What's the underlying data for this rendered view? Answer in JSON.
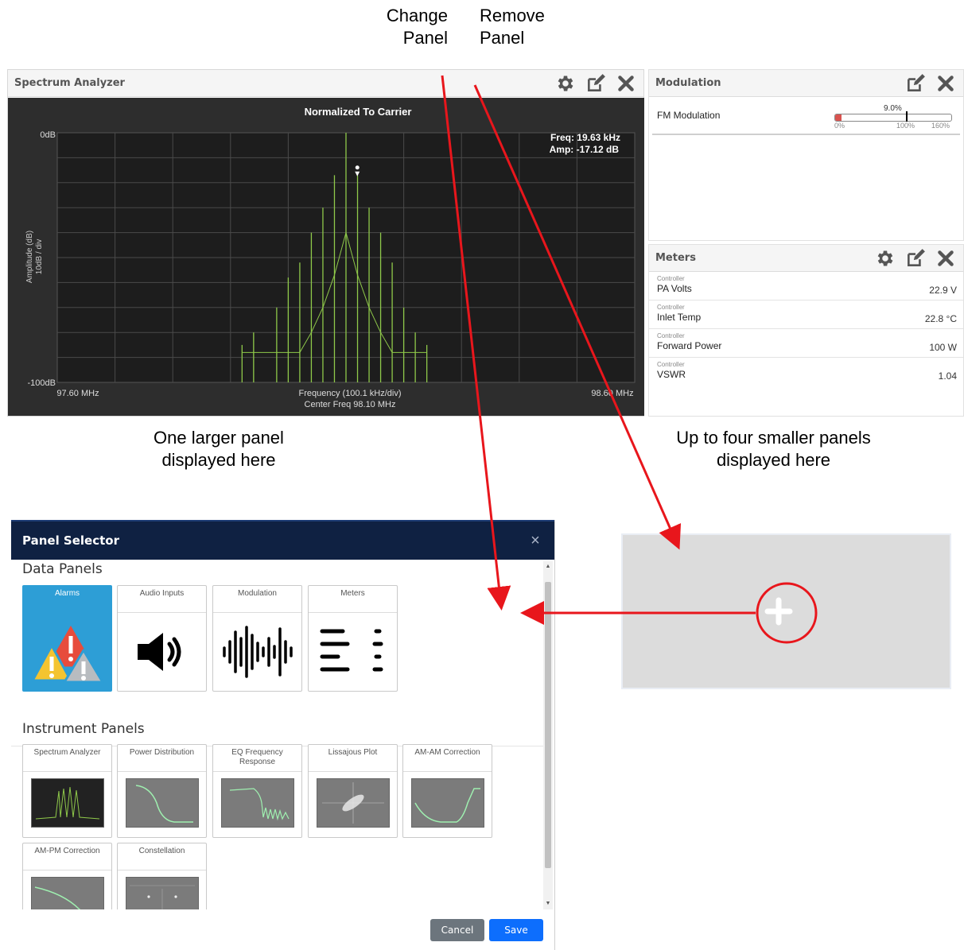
{
  "callouts": {
    "change_panel_1": "Change",
    "change_panel_2": "Panel",
    "remove_panel_1": "Remove",
    "remove_panel_2": "Panel",
    "larger_1": "One larger panel",
    "larger_2": "displayed here",
    "smaller_1": "Up to four smaller panels",
    "smaller_2": "displayed here"
  },
  "spectrum": {
    "title": "Spectrum Analyzer",
    "chart_data": {
      "type": "line",
      "title": "Normalized To Carrier",
      "ylabel": "Amplitude (dB)",
      "ylabel2": "10dB / div",
      "ytick_top": "0dB",
      "ytick_bottom": "-100dB",
      "xtick_left": "97.60 MHz",
      "xtick_right": "98.60 MHz",
      "xlabel": "Frequency (100.1 kHz/div)",
      "xlabel2": "Center Freq 98.10 MHz",
      "ylim": [
        -100,
        0
      ],
      "xlim": [
        97.6,
        98.6
      ],
      "grid": true,
      "line_color": "#8fc94a",
      "marker": {
        "freq_label": "Freq: 19.63 kHz",
        "amp_label": "Amp: -17.12 dB",
        "x": 98.1196,
        "y": -17.12
      },
      "peaks": [
        {
          "x": 97.92,
          "y": -85
        },
        {
          "x": 97.94,
          "y": -80
        },
        {
          "x": 97.98,
          "y": -70
        },
        {
          "x": 98.0,
          "y": -58
        },
        {
          "x": 98.02,
          "y": -52
        },
        {
          "x": 98.04,
          "y": -40
        },
        {
          "x": 98.06,
          "y": -30
        },
        {
          "x": 98.08,
          "y": -17
        },
        {
          "x": 98.1,
          "y": 0
        },
        {
          "x": 98.12,
          "y": -17
        },
        {
          "x": 98.14,
          "y": -30
        },
        {
          "x": 98.16,
          "y": -40
        },
        {
          "x": 98.18,
          "y": -52
        },
        {
          "x": 98.2,
          "y": -70
        },
        {
          "x": 98.22,
          "y": -80
        },
        {
          "x": 98.24,
          "y": -85
        }
      ]
    }
  },
  "modulation": {
    "title": "Modulation",
    "row_label": "FM Modulation",
    "value_label": "9.0%",
    "value": 9.0,
    "scale_max": 160,
    "ticks": [
      "0%",
      "100%",
      "160%"
    ]
  },
  "meters": {
    "title": "Meters",
    "rows": [
      {
        "source": "Controller",
        "name": "PA Volts",
        "value": "22.9 V"
      },
      {
        "source": "Controller",
        "name": "Inlet Temp",
        "value": "22.8 °C"
      },
      {
        "source": "Controller",
        "name": "Forward Power",
        "value": "100 W"
      },
      {
        "source": "Controller",
        "name": "VSWR",
        "value": "1.04"
      }
    ]
  },
  "dialog": {
    "title": "Panel Selector",
    "close_glyph": "×",
    "data_section": "Data Panels",
    "instrument_section": "Instrument Panels",
    "data_tiles": [
      "Alarms",
      "Audio Inputs",
      "Modulation",
      "Meters"
    ],
    "instrument_tiles": [
      "Spectrum Analyzer",
      "Power Distribution",
      "EQ Frequency Response",
      "Lissajous Plot",
      "AM-AM Correction",
      "AM-PM Correction",
      "Constellation"
    ],
    "cancel": "Cancel",
    "save": "Save"
  },
  "colors": {
    "accent_blue": "#2d9ed6",
    "dialog_header": "#0f2142",
    "arrow_red": "#e8161c",
    "spectrum_bg": "#2d2d2d",
    "trace_green": "#8fc94a"
  }
}
